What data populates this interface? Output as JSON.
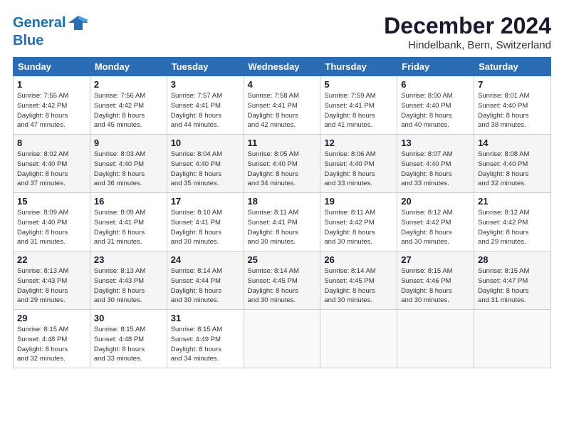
{
  "logo": {
    "line1": "General",
    "line2": "Blue"
  },
  "title": "December 2024",
  "subtitle": "Hindelbank, Bern, Switzerland",
  "days_of_week": [
    "Sunday",
    "Monday",
    "Tuesday",
    "Wednesday",
    "Thursday",
    "Friday",
    "Saturday"
  ],
  "weeks": [
    [
      {
        "day": 1,
        "info": "Sunrise: 7:55 AM\nSunset: 4:42 PM\nDaylight: 8 hours\nand 47 minutes."
      },
      {
        "day": 2,
        "info": "Sunrise: 7:56 AM\nSunset: 4:42 PM\nDaylight: 8 hours\nand 45 minutes."
      },
      {
        "day": 3,
        "info": "Sunrise: 7:57 AM\nSunset: 4:41 PM\nDaylight: 8 hours\nand 44 minutes."
      },
      {
        "day": 4,
        "info": "Sunrise: 7:58 AM\nSunset: 4:41 PM\nDaylight: 8 hours\nand 42 minutes."
      },
      {
        "day": 5,
        "info": "Sunrise: 7:59 AM\nSunset: 4:41 PM\nDaylight: 8 hours\nand 41 minutes."
      },
      {
        "day": 6,
        "info": "Sunrise: 8:00 AM\nSunset: 4:40 PM\nDaylight: 8 hours\nand 40 minutes."
      },
      {
        "day": 7,
        "info": "Sunrise: 8:01 AM\nSunset: 4:40 PM\nDaylight: 8 hours\nand 38 minutes."
      }
    ],
    [
      {
        "day": 8,
        "info": "Sunrise: 8:02 AM\nSunset: 4:40 PM\nDaylight: 8 hours\nand 37 minutes."
      },
      {
        "day": 9,
        "info": "Sunrise: 8:03 AM\nSunset: 4:40 PM\nDaylight: 8 hours\nand 36 minutes."
      },
      {
        "day": 10,
        "info": "Sunrise: 8:04 AM\nSunset: 4:40 PM\nDaylight: 8 hours\nand 35 minutes."
      },
      {
        "day": 11,
        "info": "Sunrise: 8:05 AM\nSunset: 4:40 PM\nDaylight: 8 hours\nand 34 minutes."
      },
      {
        "day": 12,
        "info": "Sunrise: 8:06 AM\nSunset: 4:40 PM\nDaylight: 8 hours\nand 33 minutes."
      },
      {
        "day": 13,
        "info": "Sunrise: 8:07 AM\nSunset: 4:40 PM\nDaylight: 8 hours\nand 33 minutes."
      },
      {
        "day": 14,
        "info": "Sunrise: 8:08 AM\nSunset: 4:40 PM\nDaylight: 8 hours\nand 32 minutes."
      }
    ],
    [
      {
        "day": 15,
        "info": "Sunrise: 8:09 AM\nSunset: 4:40 PM\nDaylight: 8 hours\nand 31 minutes."
      },
      {
        "day": 16,
        "info": "Sunrise: 8:09 AM\nSunset: 4:41 PM\nDaylight: 8 hours\nand 31 minutes."
      },
      {
        "day": 17,
        "info": "Sunrise: 8:10 AM\nSunset: 4:41 PM\nDaylight: 8 hours\nand 30 minutes."
      },
      {
        "day": 18,
        "info": "Sunrise: 8:11 AM\nSunset: 4:41 PM\nDaylight: 8 hours\nand 30 minutes."
      },
      {
        "day": 19,
        "info": "Sunrise: 8:11 AM\nSunset: 4:42 PM\nDaylight: 8 hours\nand 30 minutes."
      },
      {
        "day": 20,
        "info": "Sunrise: 8:12 AM\nSunset: 4:42 PM\nDaylight: 8 hours\nand 30 minutes."
      },
      {
        "day": 21,
        "info": "Sunrise: 8:12 AM\nSunset: 4:42 PM\nDaylight: 8 hours\nand 29 minutes."
      }
    ],
    [
      {
        "day": 22,
        "info": "Sunrise: 8:13 AM\nSunset: 4:43 PM\nDaylight: 8 hours\nand 29 minutes."
      },
      {
        "day": 23,
        "info": "Sunrise: 8:13 AM\nSunset: 4:43 PM\nDaylight: 8 hours\nand 30 minutes."
      },
      {
        "day": 24,
        "info": "Sunrise: 8:14 AM\nSunset: 4:44 PM\nDaylight: 8 hours\nand 30 minutes."
      },
      {
        "day": 25,
        "info": "Sunrise: 8:14 AM\nSunset: 4:45 PM\nDaylight: 8 hours\nand 30 minutes."
      },
      {
        "day": 26,
        "info": "Sunrise: 8:14 AM\nSunset: 4:45 PM\nDaylight: 8 hours\nand 30 minutes."
      },
      {
        "day": 27,
        "info": "Sunrise: 8:15 AM\nSunset: 4:46 PM\nDaylight: 8 hours\nand 30 minutes."
      },
      {
        "day": 28,
        "info": "Sunrise: 8:15 AM\nSunset: 4:47 PM\nDaylight: 8 hours\nand 31 minutes."
      }
    ],
    [
      {
        "day": 29,
        "info": "Sunrise: 8:15 AM\nSunset: 4:48 PM\nDaylight: 8 hours\nand 32 minutes."
      },
      {
        "day": 30,
        "info": "Sunrise: 8:15 AM\nSunset: 4:48 PM\nDaylight: 8 hours\nand 33 minutes."
      },
      {
        "day": 31,
        "info": "Sunrise: 8:15 AM\nSunset: 4:49 PM\nDaylight: 8 hours\nand 34 minutes."
      },
      null,
      null,
      null,
      null
    ]
  ]
}
